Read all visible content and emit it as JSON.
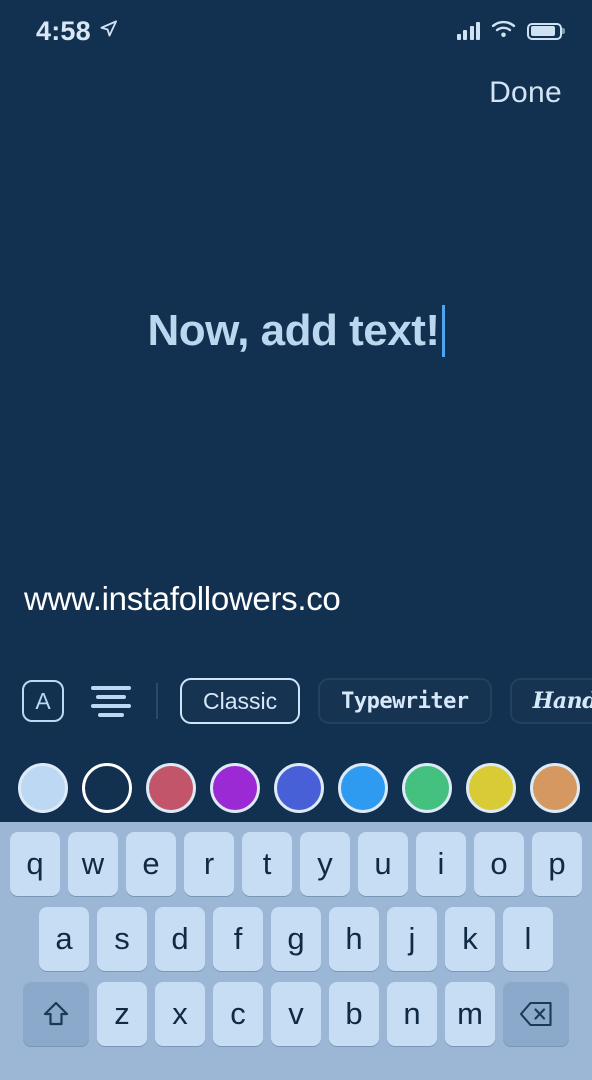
{
  "status_bar": {
    "time": "4:58",
    "location_icon": "location-arrow-icon",
    "signal_icon": "cellular-signal-icon",
    "wifi_icon": "wifi-icon",
    "battery_icon": "battery-icon",
    "battery_level_percent": 88
  },
  "nav": {
    "done_label": "Done"
  },
  "canvas": {
    "text": "Now, add text!",
    "text_color": "#bbd7ef",
    "caret_color": "#4da6f0",
    "background_color": "#12304f",
    "watermark": "www.instafollowers.co",
    "watermark_color": "#ffffff"
  },
  "text_toolbar": {
    "text_style_button": "A",
    "align_icon": "text-align-center-icon",
    "fonts": [
      {
        "label": "Classic",
        "style": "classic",
        "selected": true
      },
      {
        "label": "Typewriter",
        "style": "typewriter",
        "selected": false
      },
      {
        "label": "Handwriting",
        "style": "handwriting",
        "selected": false
      }
    ]
  },
  "color_palette": {
    "selected_index": 0,
    "swatches": [
      {
        "name": "light-blue",
        "hex": "#bcd8f2",
        "hollow": false,
        "selected": true
      },
      {
        "name": "white-outline",
        "hex": "#ffffff",
        "hollow": true,
        "selected": false
      },
      {
        "name": "rose",
        "hex": "#c25569",
        "hollow": false,
        "selected": false
      },
      {
        "name": "purple",
        "hex": "#9c2ad4",
        "hollow": false,
        "selected": false
      },
      {
        "name": "indigo",
        "hex": "#4760d8",
        "hollow": false,
        "selected": false
      },
      {
        "name": "sky-blue",
        "hex": "#2e9bf0",
        "hollow": false,
        "selected": false
      },
      {
        "name": "green",
        "hex": "#44c07f",
        "hollow": false,
        "selected": false
      },
      {
        "name": "yellow",
        "hex": "#d8cb35",
        "hollow": false,
        "selected": false
      },
      {
        "name": "tan",
        "hex": "#d59861",
        "hollow": false,
        "selected": false
      },
      {
        "name": "teal",
        "hex": "#59bcb4",
        "hollow": false,
        "selected": false
      }
    ]
  },
  "keyboard": {
    "background_color": "#9cb7d6",
    "key_color": "#c6ddf3",
    "modifier_key_color": "#8aa9cb",
    "row1": [
      "q",
      "w",
      "e",
      "r",
      "t",
      "y",
      "u",
      "i",
      "o",
      "p"
    ],
    "row2": [
      "a",
      "s",
      "d",
      "f",
      "g",
      "h",
      "j",
      "k",
      "l"
    ],
    "row3_letters": [
      "z",
      "x",
      "c",
      "v",
      "b",
      "n",
      "m"
    ],
    "shift_icon": "shift-arrow-icon",
    "backspace_icon": "backspace-delete-icon"
  }
}
